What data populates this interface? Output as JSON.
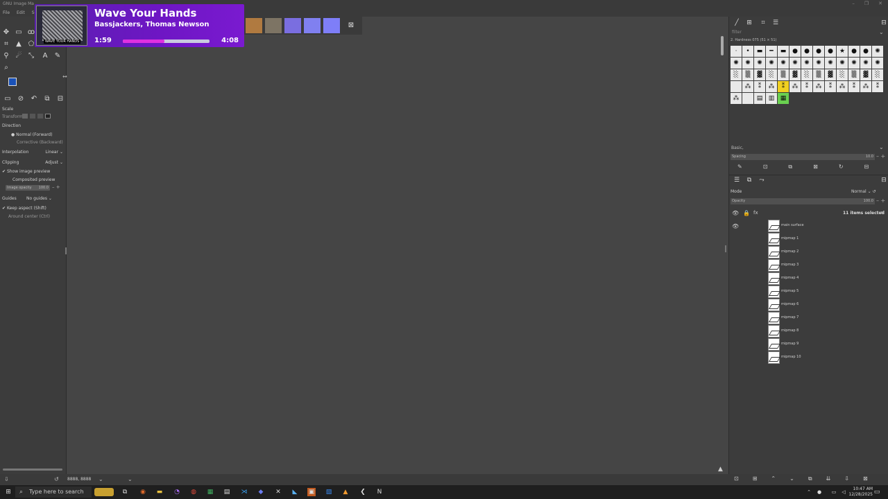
{
  "window": {
    "title": "GNU Image Ma",
    "controls": [
      "–",
      "❐",
      "✕"
    ]
  },
  "menu": {
    "items": [
      "File",
      "Edit",
      "Sele"
    ]
  },
  "media": {
    "title": "Wave Your Hands",
    "artist": "Bassjackers, Thomas Newson",
    "elapsed": "1:59",
    "total": "4:08",
    "progress": 0.48,
    "art_label": "WAVE YOUR HANDS"
  },
  "tool_options": {
    "title": "Scale",
    "transform_label": "Transform:",
    "direction_label": "Direction",
    "direction_normal": "Normal (Forward)",
    "direction_corrective": "Corrective (Backward)",
    "interpolation_label": "Interpolation",
    "interpolation_value": "Linear",
    "clipping_label": "Clipping",
    "clipping_value": "Adjust",
    "show_preview": "Show image preview",
    "composited_preview": "Composited preview",
    "image_opacity_label": "Image opacity",
    "image_opacity_value": "100.0",
    "guides_label": "Guides",
    "guides_value": "No guides",
    "keep_aspect": "Keep aspect (Shift)",
    "around_center": "Around center (Ctrl)"
  },
  "brushes": {
    "filter_placeholder": "filter",
    "current": "2. Hardness 075 (51 × 51)",
    "tag": "Basic,",
    "spacing_label": "Spacing",
    "spacing_value": "10.0"
  },
  "layers": {
    "mode_label": "Mode",
    "mode_value": "Normal",
    "opacity_label": "Opacity",
    "opacity_value": "100.0",
    "selected_count": "11 items selected",
    "items": [
      "main surface",
      "mipmap 1",
      "mipmap 2",
      "mipmap 3",
      "mipmap 4",
      "mipmap 5",
      "mipmap 6",
      "mipmap 7",
      "mipmap 8",
      "mipmap 9",
      "mipmap 10"
    ]
  },
  "status": {
    "coords": "8888, 8888"
  },
  "taskbar": {
    "search_placeholder": "Type here to search",
    "time": "10:47 AM",
    "date": "12/28/2025"
  }
}
